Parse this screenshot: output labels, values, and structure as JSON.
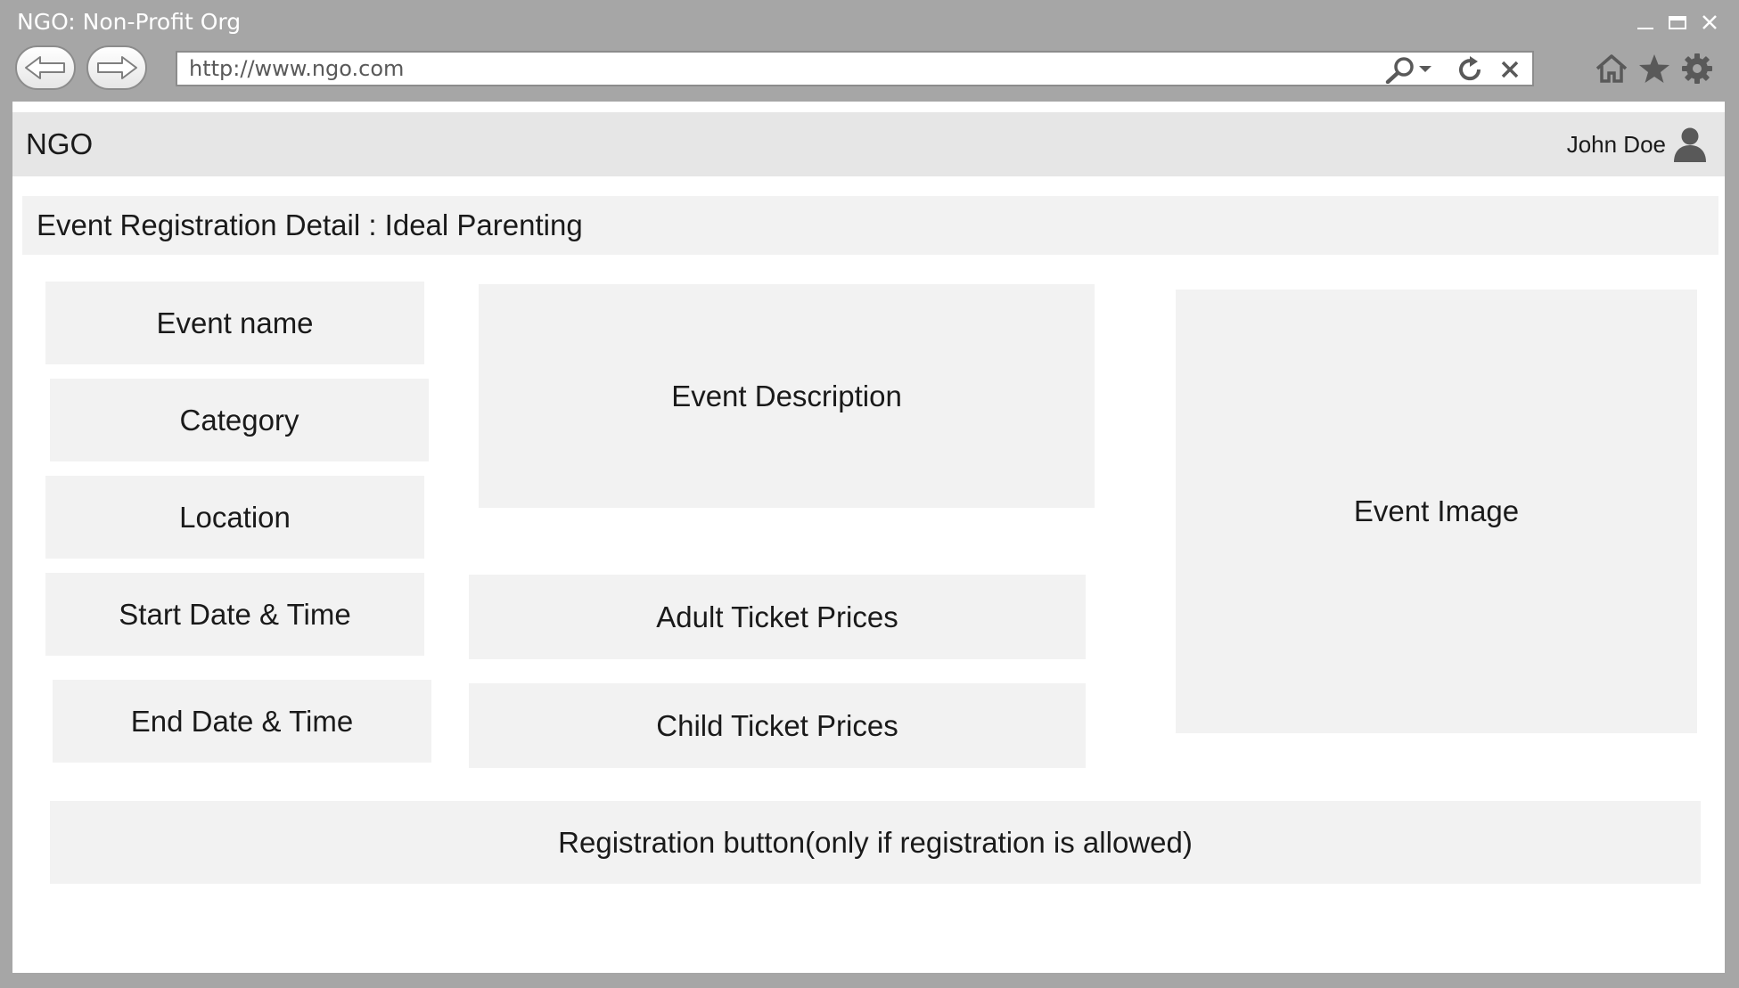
{
  "window": {
    "title": "NGO: Non-Profit Org"
  },
  "browser": {
    "url": "http://www.ngo.com"
  },
  "app": {
    "brand": "NGO",
    "user_name": "John Doe"
  },
  "page": {
    "title": "Event Registration Detail : Ideal Parenting"
  },
  "fields": {
    "event_name": "Event name",
    "category": "Category",
    "location": "Location",
    "start_datetime": "Start Date & Time",
    "end_datetime": "End Date & Time",
    "description": "Event Description",
    "adult_prices": "Adult Ticket Prices",
    "child_prices": "Child Ticket Prices",
    "image": "Event Image"
  },
  "registration": {
    "button_label": "Registration button(only if registration is allowed)"
  },
  "colors": {
    "chrome": "#a6a6a6",
    "header": "#e6e6e6",
    "panel": "#f2f2f2",
    "text": "#1a1a1a"
  }
}
